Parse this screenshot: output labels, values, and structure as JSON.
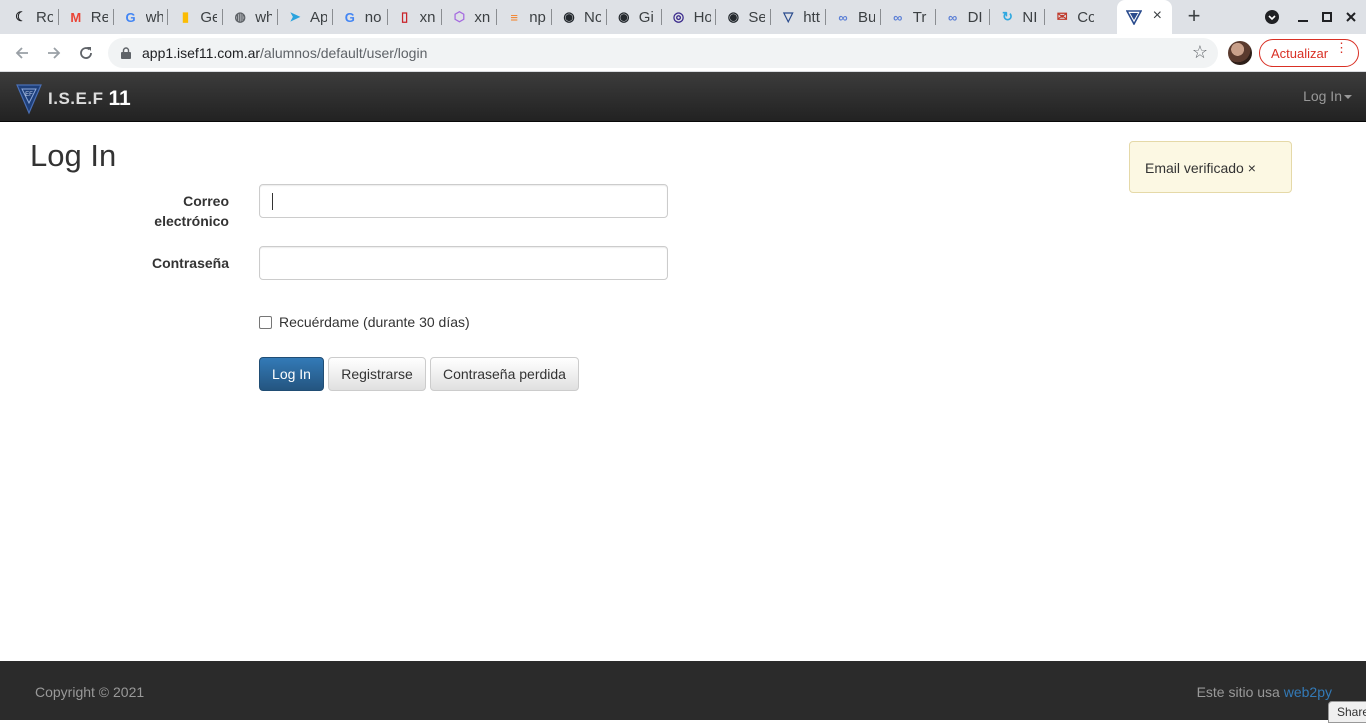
{
  "browser": {
    "tabs": [
      {
        "label": "Ro",
        "icon": "moon-icon",
        "color": "#202124",
        "glyph": "☾"
      },
      {
        "label": "Re",
        "icon": "gmail-icon",
        "color": "#ea4335",
        "glyph": "M"
      },
      {
        "label": "wh",
        "icon": "google-icon",
        "color": "#4285f4",
        "glyph": "G"
      },
      {
        "label": "Ge",
        "icon": "keep-icon",
        "color": "#fbbc04",
        "glyph": "▮"
      },
      {
        "label": "wh",
        "icon": "globe-icon",
        "color": "#5f6368",
        "glyph": "◍"
      },
      {
        "label": "Ap",
        "icon": "telegram-icon",
        "color": "#2aa3de",
        "glyph": "➤"
      },
      {
        "label": "no",
        "icon": "google-icon",
        "color": "#4285f4",
        "glyph": "G"
      },
      {
        "label": "xn",
        "icon": "opera-icon",
        "color": "#c9232a",
        "glyph": "▯"
      },
      {
        "label": "xn",
        "icon": "hexagon-icon",
        "color": "#a56ae0",
        "glyph": "⬡"
      },
      {
        "label": "np",
        "icon": "stackoverflow-icon",
        "color": "#f48024",
        "glyph": "≡"
      },
      {
        "label": "No",
        "icon": "github-icon",
        "color": "#24292e",
        "glyph": "◉"
      },
      {
        "label": "Gi",
        "icon": "github-icon",
        "color": "#24292e",
        "glyph": "◉"
      },
      {
        "label": "Ho",
        "icon": "circle-logo-icon",
        "color": "#3b2a8c",
        "glyph": "◎"
      },
      {
        "label": "Se",
        "icon": "github-icon",
        "color": "#24292e",
        "glyph": "◉"
      },
      {
        "label": "htt",
        "icon": "isef-shield-icon",
        "color": "#2a4b8d",
        "glyph": "▽"
      },
      {
        "label": "Bu",
        "icon": "link-icon",
        "color": "#5b7fd6",
        "glyph": "∞"
      },
      {
        "label": "Tr",
        "icon": "link-icon",
        "color": "#5b7fd6",
        "glyph": "∞"
      },
      {
        "label": "DI",
        "icon": "link-icon",
        "color": "#5b7fd6",
        "glyph": "∞"
      },
      {
        "label": "NI",
        "icon": "refresh-app-icon",
        "color": "#2ea8e0",
        "glyph": "↻"
      },
      {
        "label": "Co",
        "icon": "mail-red-icon",
        "color": "#c0392b",
        "glyph": "✉"
      }
    ],
    "active_tab": {
      "icon": "isef-shield-icon",
      "close": "×"
    },
    "new_tab": "+",
    "url_host": "app1.isef11.com.ar",
    "url_path": "/alumnos/default/user/login",
    "update_label": "Actualizar"
  },
  "navbar": {
    "brand_text": "I.S.E.F",
    "brand_number": "11",
    "login_menu": "Log In"
  },
  "page": {
    "title": "Log In",
    "flash": "Email verificado ×",
    "email_label_line1": "Correo",
    "email_label_line2": "electrónico",
    "email_value": "",
    "password_label": "Contraseña",
    "password_value": "",
    "remember_label": "Recuérdame (durante 30 días)",
    "remember_checked": false,
    "login_button": "Log In",
    "register_button": "Registrarse",
    "lost_password_button": "Contraseña perdida"
  },
  "footer": {
    "copyright": "Copyright © 2021",
    "powered_prefix": "Este sitio usa",
    "powered_link": "web2py",
    "share": "Share"
  },
  "colors": {
    "primary": "#337ab7",
    "navbar": "#222222",
    "flash_bg": "#fcf8e3",
    "footer": "#2b2b2b"
  }
}
